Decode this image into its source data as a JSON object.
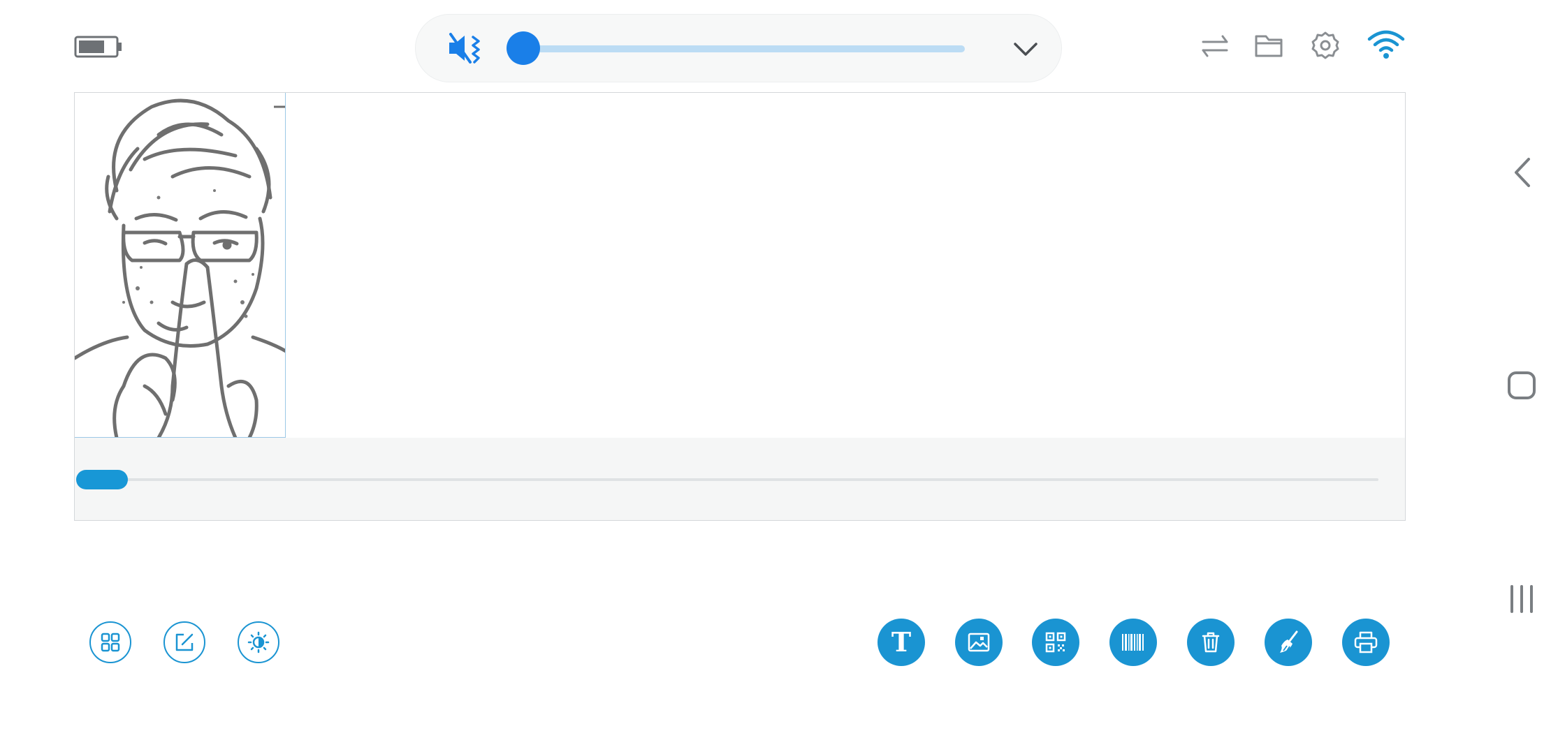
{
  "status": {
    "battery_icon": "battery-icon",
    "battery_level": 0.6
  },
  "volume": {
    "icon": "volume-mute-icon",
    "level": 0.0,
    "expand_icon": "chevron-down-icon",
    "accent_color": "#1a7fe8",
    "track_color": "#bcdcf4"
  },
  "toolbar_top": {
    "icons": [
      "swap-icon",
      "folder-icon",
      "gear-icon",
      "wifi-icon"
    ]
  },
  "canvas": {
    "image_alt": "sketch portrait",
    "scroll_position": 0.0,
    "scroll_visible_fraction": 0.04
  },
  "tools_left": [
    "layout-icon",
    "edit-icon",
    "brightness-icon"
  ],
  "tools_right": [
    {
      "name": "text-tool",
      "glyph": "T"
    },
    {
      "name": "image-tool",
      "glyph": ""
    },
    {
      "name": "qrcode-tool",
      "glyph": ""
    },
    {
      "name": "barcode-tool",
      "glyph": ""
    },
    {
      "name": "delete-tool",
      "glyph": ""
    },
    {
      "name": "clear-tool",
      "glyph": ""
    },
    {
      "name": "print-tool",
      "glyph": ""
    }
  ],
  "colors": {
    "brand": "#1a94d2",
    "icon_gray": "#8a8e92"
  },
  "nav": [
    "back-icon",
    "home-icon",
    "recents-icon"
  ]
}
